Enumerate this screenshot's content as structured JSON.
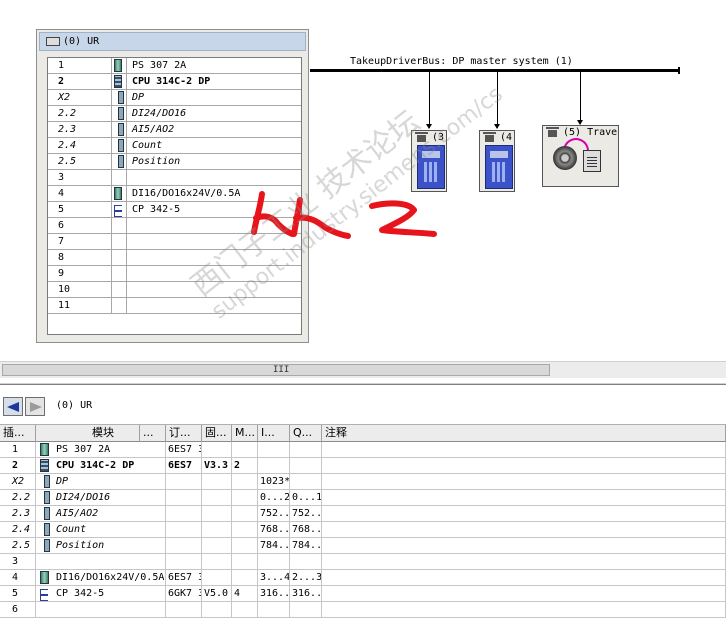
{
  "rack": {
    "title": "(0) UR",
    "rows": [
      {
        "slot": "1",
        "module": "PS 307 2A",
        "style": "",
        "icon": "module"
      },
      {
        "slot": "2",
        "module": "CPU 314C-2 DP",
        "style": "bold",
        "icon": "cpu"
      },
      {
        "slot": "X2",
        "module": "DP",
        "style": "ital",
        "icon": "sub"
      },
      {
        "slot": "2.2",
        "module": "DI24/DO16",
        "style": "ital",
        "icon": "sub"
      },
      {
        "slot": "2.3",
        "module": "AI5/AO2",
        "style": "ital",
        "icon": "sub"
      },
      {
        "slot": "2.4",
        "module": "Count",
        "style": "ital",
        "icon": "sub"
      },
      {
        "slot": "2.5",
        "module": "Position",
        "style": "ital",
        "icon": "sub"
      },
      {
        "slot": "3",
        "module": "",
        "style": "",
        "icon": ""
      },
      {
        "slot": "4",
        "module": "DI16/DO16x24V/0.5A",
        "style": "",
        "icon": "module"
      },
      {
        "slot": "5",
        "module": "CP 342-5",
        "style": "",
        "icon": "cp"
      },
      {
        "slot": "6",
        "module": "",
        "style": "",
        "icon": ""
      },
      {
        "slot": "7",
        "module": "",
        "style": "",
        "icon": ""
      },
      {
        "slot": "8",
        "module": "",
        "style": "",
        "icon": ""
      },
      {
        "slot": "9",
        "module": "",
        "style": "",
        "icon": ""
      },
      {
        "slot": "10",
        "module": "",
        "style": "",
        "icon": ""
      },
      {
        "slot": "11",
        "module": "",
        "style": "",
        "icon": ""
      }
    ]
  },
  "network": {
    "bus_label": "TakeupDriverBus: DP master system (1)",
    "nodes": [
      {
        "label": "(3",
        "kind": "drive"
      },
      {
        "label": "(4",
        "kind": "drive"
      },
      {
        "label": "(5) Trave",
        "kind": "motor"
      }
    ]
  },
  "annotation": {
    "color": "#e8141c"
  },
  "watermark": {
    "line1": "西门子工业 技术论坛",
    "line2": "support.industry.siemens.com/cs"
  },
  "scrollbar": {
    "grip": "III"
  },
  "detail": {
    "title": "(0)   UR",
    "columns": [
      "插...",
      "模块",
      "...",
      "订...",
      "固...",
      "M...",
      "I...",
      "Q...",
      "注释"
    ],
    "rows": [
      {
        "slot": "1",
        "module": "PS 307 2A",
        "order": "6ES7 3",
        "fw": "",
        "mpi": "",
        "i": "",
        "q": "",
        "comment": "",
        "style": "",
        "icon": "module"
      },
      {
        "slot": "2",
        "module": "CPU 314C-2 DP",
        "order": "6ES7",
        "fw": "V3.3",
        "mpi": "2",
        "i": "",
        "q": "",
        "comment": "",
        "style": "bold",
        "icon": "cpu"
      },
      {
        "slot": "X2",
        "module": "DP",
        "order": "",
        "fw": "",
        "mpi": "",
        "i": "1023*",
        "q": "",
        "comment": "",
        "style": "ital",
        "icon": "sub"
      },
      {
        "slot": "2.2",
        "module": "DI24/DO16",
        "order": "",
        "fw": "",
        "mpi": "",
        "i": "0...2",
        "q": "0...1",
        "comment": "",
        "style": "ital",
        "icon": "sub"
      },
      {
        "slot": "2.3",
        "module": "AI5/AO2",
        "order": "",
        "fw": "",
        "mpi": "",
        "i": "752...",
        "q": "752...",
        "comment": "",
        "style": "ital",
        "icon": "sub"
      },
      {
        "slot": "2.4",
        "module": "Count",
        "order": "",
        "fw": "",
        "mpi": "",
        "i": "768...",
        "q": "768...",
        "comment": "",
        "style": "ital",
        "icon": "sub"
      },
      {
        "slot": "2.5",
        "module": "Position",
        "order": "",
        "fw": "",
        "mpi": "",
        "i": "784...",
        "q": "784...",
        "comment": "",
        "style": "ital",
        "icon": "sub"
      },
      {
        "slot": "3",
        "module": "",
        "order": "",
        "fw": "",
        "mpi": "",
        "i": "",
        "q": "",
        "comment": "",
        "style": "",
        "icon": ""
      },
      {
        "slot": "4",
        "module": "DI16/DO16x24V/0.5A",
        "order": "6ES7 3",
        "fw": "",
        "mpi": "",
        "i": "3...4",
        "q": "2...3",
        "comment": "",
        "style": "",
        "icon": "module"
      },
      {
        "slot": "5",
        "module": "CP 342-5",
        "order": "6GK7 3",
        "fw": "V5.0",
        "mpi": "4",
        "i": "316...",
        "q": "316...",
        "comment": "",
        "style": "",
        "icon": "cp"
      },
      {
        "slot": "6",
        "module": "",
        "order": "",
        "fw": "",
        "mpi": "",
        "i": "",
        "q": "",
        "comment": "",
        "style": "",
        "icon": ""
      }
    ]
  }
}
